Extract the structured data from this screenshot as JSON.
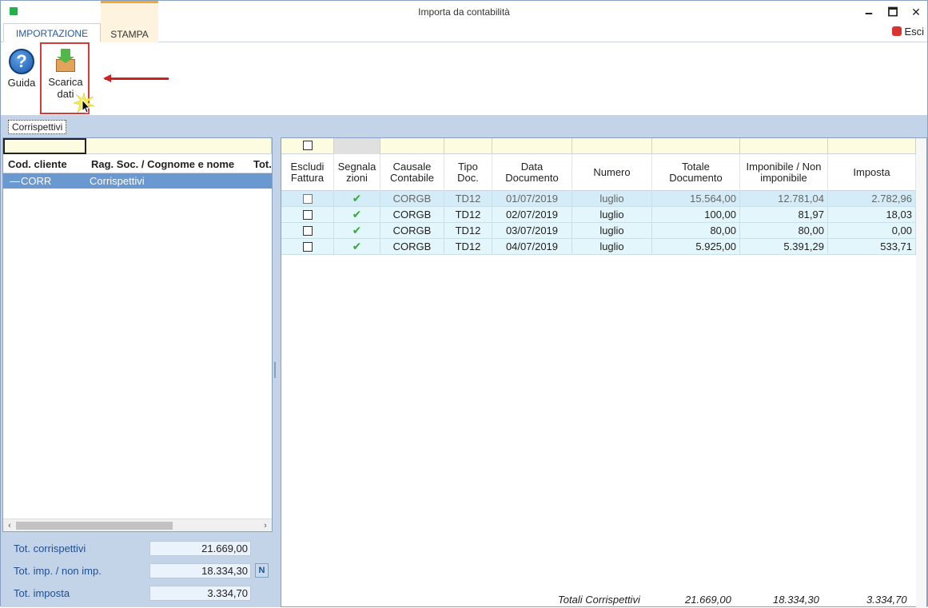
{
  "window": {
    "title": "Importa da contabilità",
    "minimize": "🗕",
    "maximize": "🗖",
    "close": "✕"
  },
  "ribbon": {
    "tabs": {
      "importazione": "IMPORTAZIONE",
      "stampa": "STAMPA"
    },
    "esci": "Esci",
    "guida": "Guida",
    "scarica_line1": "Scarica",
    "scarica_line2": "dati"
  },
  "subtab": "Corrispettivi",
  "left": {
    "columns": {
      "cod": "Cod. cliente",
      "rag": "Rag. Soc. / Cognome e nome",
      "tot": "Tot."
    },
    "row": {
      "cod": "CORR",
      "rag": "Corrispettivi"
    },
    "totals": {
      "corrispettivi_label": "Tot. corrispettivi",
      "corrispettivi_value": "21.669,00",
      "imp_label": "Tot. imp. / non imp.",
      "imp_value": "18.334,30",
      "imp_badge": "N",
      "imposta_label": "Tot. imposta",
      "imposta_value": "3.334,70"
    }
  },
  "right": {
    "columns": {
      "escludi_1": "Escludi",
      "escludi_2": "Fattura",
      "segnala_1": "Segnala",
      "segnala_2": "zioni",
      "causale_1": "Causale",
      "causale_2": "Contabile",
      "tipo_1": "Tipo",
      "tipo_2": "Doc.",
      "data_1": "Data",
      "data_2": "Documento",
      "numero": "Numero",
      "totale_1": "Totale",
      "totale_2": "Documento",
      "imponibile_1": "Imponibile / Non",
      "imponibile_2": "imponibile",
      "imposta": "Imposta"
    },
    "rows": [
      {
        "causale": "CORGB",
        "tipo": "TD12",
        "data": "01/07/2019",
        "numero": "luglio",
        "totale": "15.564,00",
        "imponibile": "12.781,04",
        "imposta": "2.782,96"
      },
      {
        "causale": "CORGB",
        "tipo": "TD12",
        "data": "02/07/2019",
        "numero": "luglio",
        "totale": "100,00",
        "imponibile": "81,97",
        "imposta": "18,03"
      },
      {
        "causale": "CORGB",
        "tipo": "TD12",
        "data": "03/07/2019",
        "numero": "luglio",
        "totale": "80,00",
        "imponibile": "80,00",
        "imposta": "0,00"
      },
      {
        "causale": "CORGB",
        "tipo": "TD12",
        "data": "04/07/2019",
        "numero": "luglio",
        "totale": "5.925,00",
        "imponibile": "5.391,29",
        "imposta": "533,71"
      }
    ],
    "totals": {
      "label": "Totali  Corrispettivi",
      "totale": "21.669,00",
      "imponibile": "18.334,30",
      "imposta": "3.334,70"
    }
  }
}
